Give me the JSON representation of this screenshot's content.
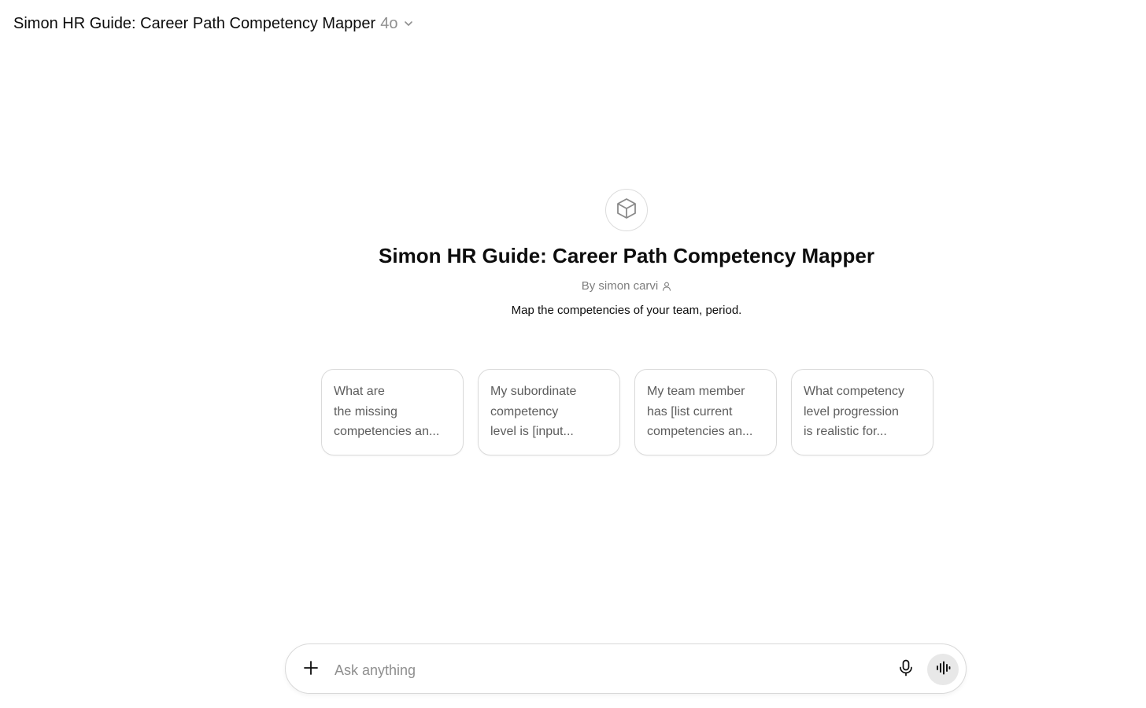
{
  "header": {
    "title": "Simon HR Guide: Career Path Competency Mapper",
    "model": "4o",
    "dropdown_icon": "chevron-down-icon"
  },
  "gpt": {
    "icon": "cube-icon",
    "name": "Simon HR Guide: Career Path Competency Mapper",
    "author": "By simon carvi",
    "author_icon": "person-icon",
    "description": "Map the competencies of your team, period."
  },
  "starters": [
    {
      "lines": [
        "What are",
        "the missing",
        "competencies an..."
      ]
    },
    {
      "lines": [
        "My subordinate",
        "competency",
        "level is [input..."
      ]
    },
    {
      "lines": [
        "My team member",
        "has [list current",
        "competencies an..."
      ]
    },
    {
      "lines": [
        "What competency",
        "level progression",
        "is realistic for..."
      ]
    }
  ],
  "composer": {
    "placeholder": "Ask anything",
    "value": "",
    "attach_icon": "plus-icon",
    "mic_icon": "microphone-icon",
    "voice_icon": "voice-mode-icon"
  },
  "colors": {
    "text": "#0d0d0d",
    "muted": "#8f8f8f",
    "border": "#dadada",
    "voice_button_bg": "#e8e8e8"
  }
}
